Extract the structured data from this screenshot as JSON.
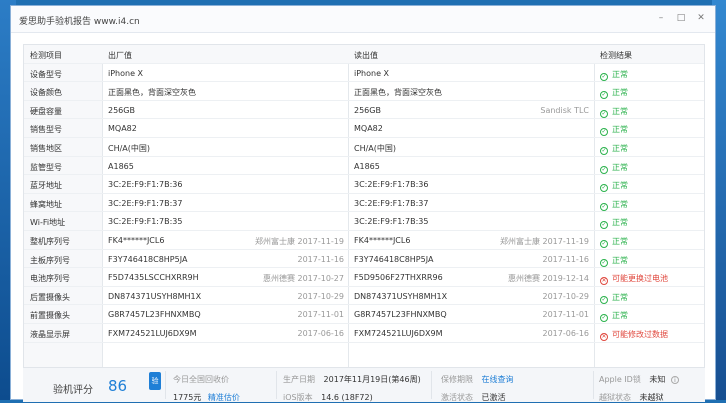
{
  "window": {
    "title": "爱思助手验机报告 www.i4.cn",
    "controls": [
      "minimize-icon",
      "maximize-icon",
      "close-icon"
    ]
  },
  "table": {
    "columns": [
      "检测项目",
      "出厂值",
      "读出值",
      "检测结果"
    ],
    "rows": [
      {
        "name": "设备型号",
        "factory": "iPhone X",
        "factory_note": "",
        "read": "iPhone X",
        "read_note": "",
        "result": "正常",
        "status": "ok"
      },
      {
        "name": "设备颜色",
        "factory": "正面黑色，背面深空灰色",
        "factory_note": "",
        "read": "正面黑色，背面深空灰色",
        "read_note": "",
        "result": "正常",
        "status": "ok"
      },
      {
        "name": "硬盘容量",
        "factory": "256GB",
        "factory_note": "",
        "read": "256GB",
        "read_note": "Sandisk TLC",
        "result": "正常",
        "status": "ok"
      },
      {
        "name": "销售型号",
        "factory": "MQA82",
        "factory_note": "",
        "read": "MQA82",
        "read_note": "",
        "result": "正常",
        "status": "ok"
      },
      {
        "name": "销售地区",
        "factory": "CH/A(中国)",
        "factory_note": "",
        "read": "CH/A(中国)",
        "read_note": "",
        "result": "正常",
        "status": "ok"
      },
      {
        "name": "监管型号",
        "factory": "A1865",
        "factory_note": "",
        "read": "A1865",
        "read_note": "",
        "result": "正常",
        "status": "ok"
      },
      {
        "name": "蓝牙地址",
        "factory": "3C:2E:F9:F1:7B:36",
        "factory_note": "",
        "read": "3C:2E:F9:F1:7B:36",
        "read_note": "",
        "result": "正常",
        "status": "ok"
      },
      {
        "name": "蜂窝地址",
        "factory": "3C:2E:F9:F1:7B:37",
        "factory_note": "",
        "read": "3C:2E:F9:F1:7B:37",
        "read_note": "",
        "result": "正常",
        "status": "ok"
      },
      {
        "name": "Wi-Fi地址",
        "factory": "3C:2E:F9:F1:7B:35",
        "factory_note": "",
        "read": "3C:2E:F9:F1:7B:35",
        "read_note": "",
        "result": "正常",
        "status": "ok"
      },
      {
        "name": "整机序列号",
        "factory": "FK4******JCL6",
        "factory_note": "郑州富士康  2017-11-19",
        "read": "FK4******JCL6",
        "read_note": "郑州富士康  2017-11-19",
        "result": "正常",
        "status": "ok"
      },
      {
        "name": "主板序列号",
        "factory": "F3Y746418C8HP5JA",
        "factory_note": "2017-11-16",
        "read": "F3Y746418C8HP5JA",
        "read_note": "2017-11-16",
        "result": "正常",
        "status": "ok"
      },
      {
        "name": "电池序列号",
        "factory": "F5D7435LSCCHXRR9H",
        "factory_note": "惠州德赛  2017-10-27",
        "read": "F5D9506F27THXRR96",
        "read_note": "惠州德赛  2019-12-14",
        "result": "可能更换过电池",
        "status": "bad"
      },
      {
        "name": "后置摄像头",
        "factory": "DN874371USYH8MH1X",
        "factory_note": "2017-10-29",
        "read": "DN874371USYH8MH1X",
        "read_note": "2017-10-29",
        "result": "正常",
        "status": "ok"
      },
      {
        "name": "前置摄像头",
        "factory": "G8R7457L23FHNXMBQ",
        "factory_note": "2017-11-01",
        "read": "G8R7457L23FHNXMBQ",
        "read_note": "2017-11-01",
        "result": "正常",
        "status": "ok"
      },
      {
        "name": "液晶显示屏",
        "factory": "FXM724521LUJ6DX9M",
        "factory_note": "2017-06-16",
        "read": "FXM724521LUJ6DX9M",
        "read_note": "2017-06-16",
        "result": "可能修改过数据",
        "status": "bad"
      }
    ]
  },
  "summary": {
    "score_label": "验机评分",
    "score_value": "86",
    "badge": "验",
    "price_label": "今日全国回收价",
    "price_value": "1775元",
    "price_link": "精准估价",
    "production_label": "生产日期",
    "production_value": "2017年11月19日(第46周)",
    "ios_label": "iOS版本",
    "ios_value": "14.6 (18F72)",
    "warranty_label": "保修期限",
    "warranty_link": "在线查询",
    "activation_label": "激活状态",
    "activation_value": "已激活",
    "appleid_label": "Apple ID锁",
    "appleid_value": "未知",
    "jailbreak_label": "越狱状态",
    "jailbreak_value": "未越狱"
  },
  "colors": {
    "accent": "#1f7fd6",
    "ok": "#2bb24c",
    "bad": "#e0483e"
  }
}
